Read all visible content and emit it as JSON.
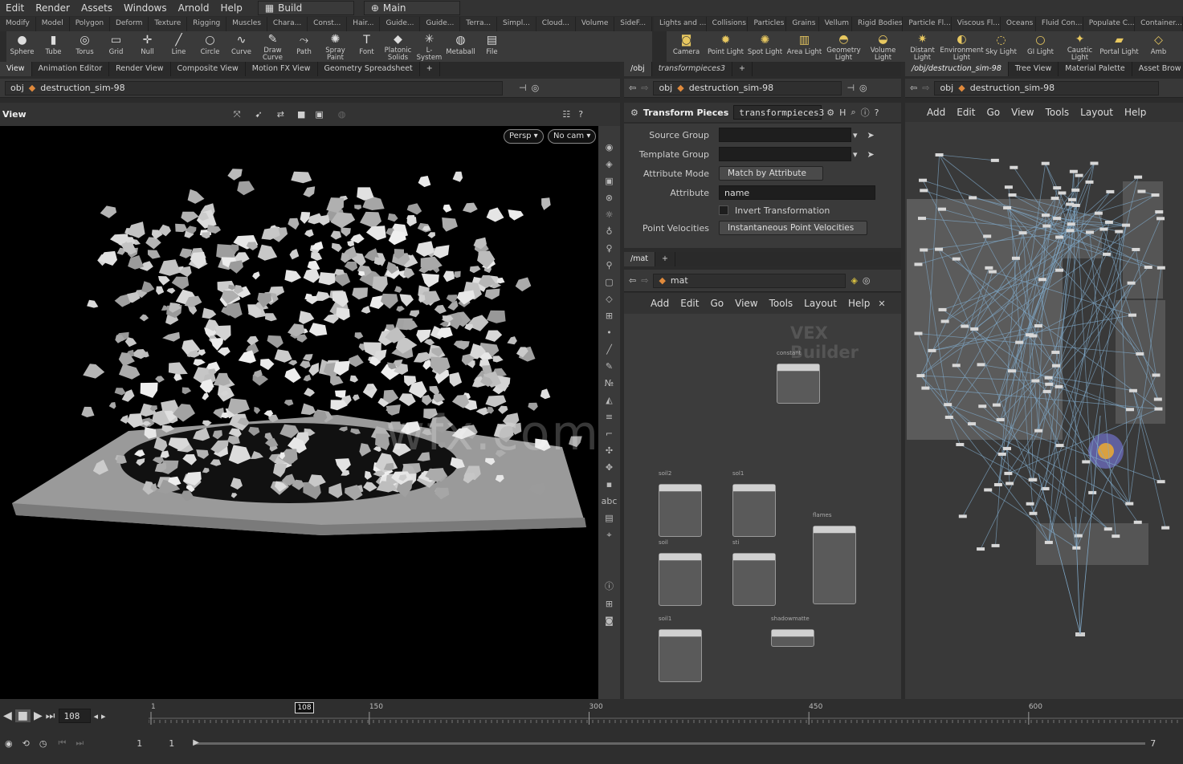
{
  "menubar": {
    "items": [
      "Edit",
      "Render",
      "Assets",
      "Windows",
      "Arnold",
      "Help"
    ],
    "desktop": "Build",
    "context": "Main"
  },
  "shelf_left": {
    "tabs": [
      "Modify",
      "Model",
      "Polygon",
      "Deform",
      "Texture",
      "Rigging",
      "Muscles",
      "Chara...",
      "Const...",
      "Hair...",
      "Guide...",
      "Guide...",
      "Terra...",
      "Simpl...",
      "Cloud...",
      "Volume",
      "SideF..."
    ],
    "tools": [
      "Sphere",
      "Tube",
      "Torus",
      "Grid",
      "Null",
      "Line",
      "Circle",
      "Curve",
      "Draw Curve",
      "Path",
      "Spray Paint",
      "Font",
      "Platonic Solids",
      "L-System",
      "Metaball",
      "File"
    ]
  },
  "shelf_right": {
    "tabs": [
      "Lights and ...",
      "Collisions",
      "Particles",
      "Grains",
      "Vellum",
      "Rigid Bodies",
      "Particle Fl...",
      "Viscous Fl...",
      "Oceans",
      "Fluid Con...",
      "Populate C...",
      "Container..."
    ],
    "tools": [
      "Camera",
      "Point Light",
      "Spot Light",
      "Area Light",
      "Geometry Light",
      "Volume Light",
      "Distant Light",
      "Environment Light",
      "Sky Light",
      "GI Light",
      "Caustic Light",
      "Portal Light",
      "Amb"
    ]
  },
  "viewer": {
    "tabs": [
      "View",
      "Animation Editor",
      "Render View",
      "Composite View",
      "Motion FX View",
      "Geometry Spreadsheet"
    ],
    "path_root": "obj",
    "path_node": "destruction_sim-98",
    "title": "View",
    "persp_label": "Persp",
    "cam_label": "No cam",
    "side_tool_label": "abc"
  },
  "params": {
    "tabs": [
      "/obj",
      "transformpieces3"
    ],
    "path_root": "obj",
    "path_node": "destruction_sim-98",
    "node_type": "Transform Pieces",
    "node_name": "transformpieces3",
    "rows": [
      {
        "label": "Source Group",
        "value": ""
      },
      {
        "label": "Template Group",
        "value": ""
      },
      {
        "label": "Attribute Mode",
        "value": "Match by Attribute"
      },
      {
        "label": "Attribute",
        "value": "name"
      },
      {
        "label": "Point Velocities",
        "value": "Instantaneous Point Velocities"
      }
    ],
    "checkbox_label": "Invert Transformation"
  },
  "mat": {
    "tab": "/mat",
    "path": "mat",
    "menu": [
      "Add",
      "Edit",
      "Go",
      "View",
      "Tools",
      "Layout",
      "Help"
    ],
    "context_title": "VEX Builder",
    "nodes": [
      "constant",
      "soil2",
      "sol1",
      "soil",
      "sti",
      "flames",
      "soil1",
      "shadowmatte"
    ]
  },
  "network": {
    "tabs": [
      "/obj/destruction_sim-98",
      "Tree View",
      "Material Palette",
      "Asset Brow"
    ],
    "path_root": "obj",
    "path_node": "destruction_sim-98",
    "menu": [
      "Add",
      "Edit",
      "Go",
      "View",
      "Tools",
      "Layout",
      "Help"
    ]
  },
  "timeline": {
    "current_frame": "108",
    "frame_marker": "108",
    "ticks": [
      "1",
      "150",
      "300",
      "450",
      "600"
    ],
    "start_frame": "1",
    "range_start": "1",
    "range_end_partial": "7"
  },
  "watermark": "wfx.com"
}
